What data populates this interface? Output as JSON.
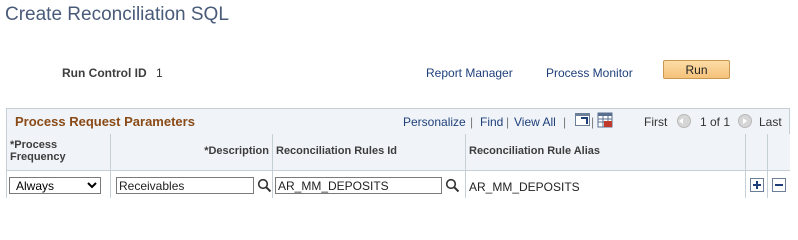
{
  "page": {
    "title": "Create Reconciliation SQL"
  },
  "run_control": {
    "label": "Run Control ID",
    "value": "1"
  },
  "links": {
    "report_manager": "Report Manager",
    "process_monitor": "Process Monitor"
  },
  "run_button": {
    "label": "Run"
  },
  "grid": {
    "title": "Process Request Parameters",
    "toolbar": {
      "personalize": "Personalize",
      "separator": "|",
      "find": "Find",
      "view_all": "View All",
      "first": "First",
      "pagination": "1 of 1",
      "last": "Last"
    },
    "columns": {
      "frequency": "*Process Frequency",
      "description": "*Description",
      "rules_id": "Reconciliation Rules Id",
      "alias": "Reconciliation Rule Alias"
    },
    "row": {
      "frequency": "Always",
      "description": "Receivables",
      "rules_id": "AR_MM_DEPOSITS",
      "alias": "AR_MM_DEPOSITS"
    }
  }
}
